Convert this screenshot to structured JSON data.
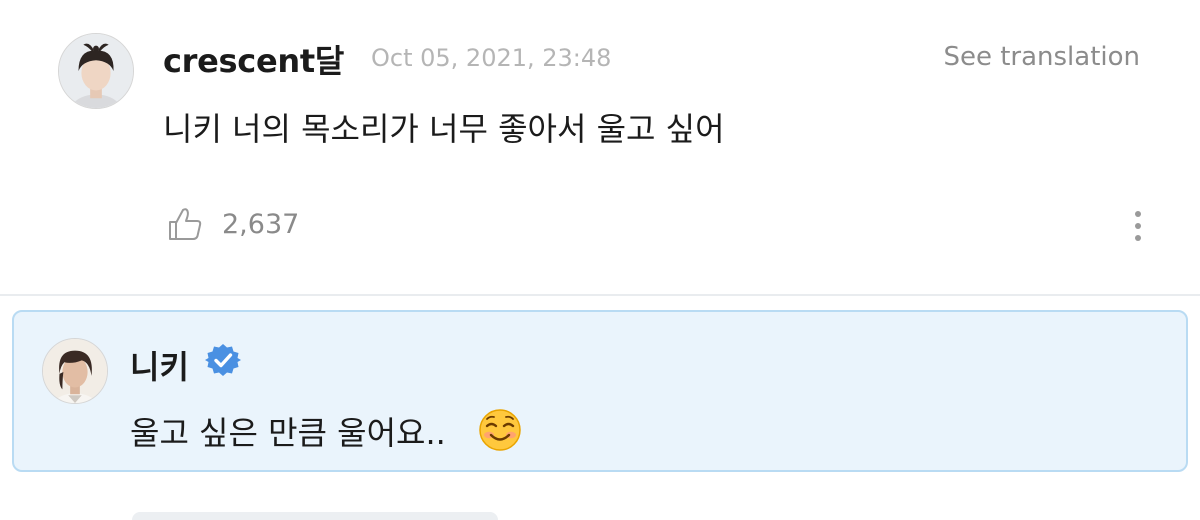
{
  "comment": {
    "username": "crescent달",
    "timestamp": "Oct 05, 2021, 23:48",
    "translate_label": "See translation",
    "text": "니키 너의 목소리가 너무 좋아서 울고 싶어",
    "like_count": "2,637",
    "like_icon": "thumbs-up-icon",
    "more_icon": "more-vertical-icon",
    "avatar": "user-avatar"
  },
  "reply": {
    "name": "니키",
    "verified_icon": "verified-badge-icon",
    "text": "울고 싶은 만큼 울어요..",
    "emoji": "smiling-face-emoji",
    "avatar": "artist-avatar"
  },
  "colors": {
    "reply_background": "#eaf4fc",
    "reply_border": "#b9dbf3",
    "verified_blue": "#4a90e2",
    "muted_text": "#8c8c8c",
    "divider": "#e9ecef"
  }
}
